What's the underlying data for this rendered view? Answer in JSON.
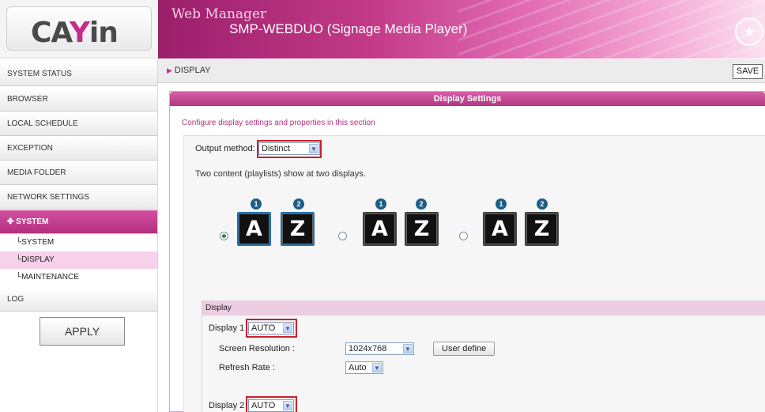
{
  "header": {
    "logo_text_left": "CA",
    "logo_text_mid": "Y",
    "logo_text_right": "in",
    "app_title": "Web Manager",
    "device_name": "SMP-WEBDUO (Signage Media Player)",
    "wand_icon": "magic-wand-icon"
  },
  "sidebar": {
    "items": [
      {
        "label": "SYSTEM STATUS"
      },
      {
        "label": "BROWSER"
      },
      {
        "label": "LOCAL SCHEDULE"
      },
      {
        "label": "EXCEPTION"
      },
      {
        "label": "MEDIA FOLDER"
      },
      {
        "label": "NETWORK SETTINGS"
      },
      {
        "label": "SYSTEM"
      },
      {
        "label": "LOG"
      }
    ],
    "sub_items": [
      {
        "label": "└SYSTEM"
      },
      {
        "label": "└DISPLAY"
      },
      {
        "label": "└MAINTENANCE"
      }
    ],
    "apply_label": "APPLY",
    "active_color": "#c2388a"
  },
  "main": {
    "breadcrumb": "DISPLAY",
    "save_label": "SAVE",
    "panel_title": "Display Settings",
    "panel_description": "Configure display settings and properties in this section",
    "output_method_label": "Output method:",
    "output_method_value": "Distinct",
    "output_description": "Two content (playlists) show at two displays.",
    "layout_options": [
      {
        "selected": true,
        "badges": [
          "1",
          "2"
        ],
        "screens": [
          "A",
          "Z"
        ]
      },
      {
        "selected": false,
        "badges": [
          "1",
          "2"
        ],
        "screens": [
          "A",
          "Z"
        ]
      },
      {
        "selected": false,
        "badges": [
          "1",
          "2"
        ],
        "screens": [
          "A",
          "Z"
        ]
      }
    ],
    "display_section": {
      "title": "Display",
      "display1_label": "Display 1",
      "display1_value": "AUTO",
      "screen_resolution_label": "Screen Resolution :",
      "screen_resolution_value": "1024x768",
      "user_define_label": "User define",
      "refresh_rate_label": "Refresh Rate :",
      "refresh_rate_value": "Auto",
      "display2_label": "Display 2",
      "display2_value": "AUTO"
    }
  }
}
